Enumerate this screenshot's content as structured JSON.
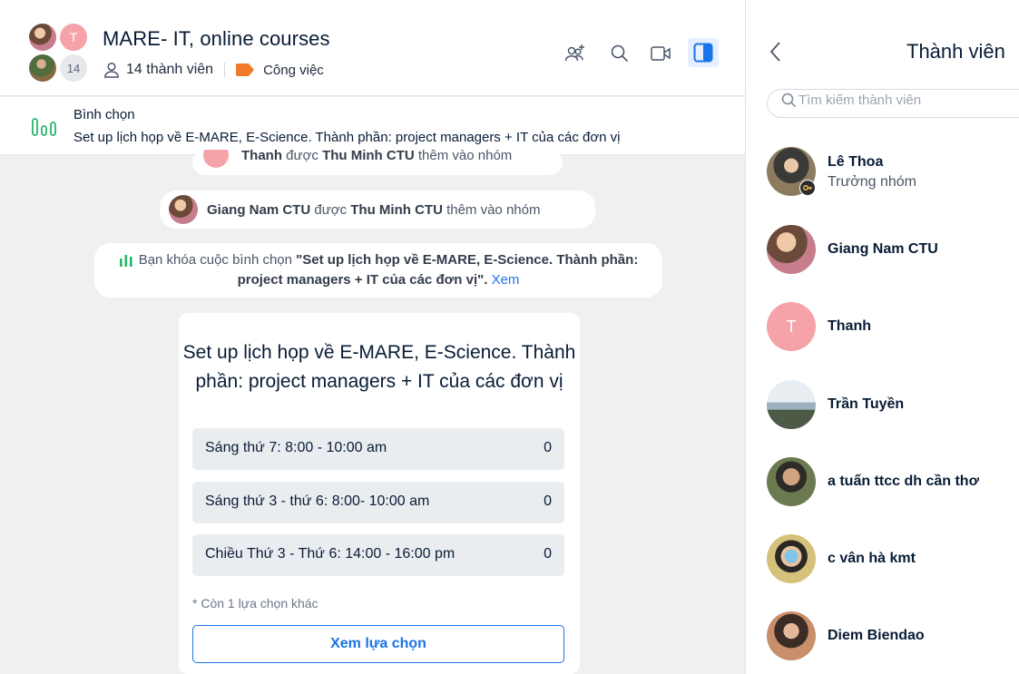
{
  "header": {
    "title": "MARE- IT, online courses",
    "avatar_initial": "T",
    "avatar_count": "14",
    "member_count": "14 thành viên",
    "category": "Công việc",
    "colors": {
      "category": "#f07c2a",
      "accent": "#1a73e8"
    }
  },
  "toolbar": {
    "icons": [
      "add-member-icon",
      "search-icon",
      "video-call-icon",
      "toggle-panel-icon"
    ]
  },
  "pinned": {
    "title": "Bình chọn",
    "text": "Set up lịch họp về E-MARE, E-Science. Thành phần: project managers + IT của các đơn vị"
  },
  "notices": [
    {
      "actor": "Thanh",
      "verb": "được",
      "by": "Thu Minh CTU",
      "tail": "thêm vào nhóm"
    },
    {
      "actor": "Giang Nam CTU",
      "verb": "được",
      "by": "Thu Minh CTU",
      "tail": "thêm vào nhóm"
    },
    {
      "prefix": "Bạn khóa cuộc bình chọn",
      "quoted": "\"Set up lịch họp về E-MARE, E-Science. Thành phần: project managers + IT của các đơn vị\".",
      "link": "Xem"
    }
  ],
  "poll": {
    "question": "Set up lịch họp về E-MARE, E-Science. Thành phần: project managers + IT của các đơn vị",
    "options": [
      {
        "label": "Sáng thứ 7: 8:00 - 10:00 am",
        "count": "0"
      },
      {
        "label": "Sáng thứ 3 - thứ 6: 8:00- 10:00 am",
        "count": "0"
      },
      {
        "label": "Chiều Thứ 3 - Thứ 6: 14:00 - 16:00 pm",
        "count": "0"
      }
    ],
    "more": "* Còn 1 lựa chọn khác",
    "button": "Xem lựa chọn"
  },
  "members_panel": {
    "title": "Thành viên",
    "search_placeholder": "Tìm kiếm thành viên",
    "members": [
      {
        "name": "Lê Thoa",
        "role": "Trưởng nhóm"
      },
      {
        "name": "Giang Nam CTU"
      },
      {
        "name": "Thanh",
        "initial": "T"
      },
      {
        "name": "Trần Tuyền"
      },
      {
        "name": "a tuấn ttcc dh cần thơ"
      },
      {
        "name": "c vân hà kmt"
      },
      {
        "name": "Diem Biendao"
      }
    ]
  }
}
